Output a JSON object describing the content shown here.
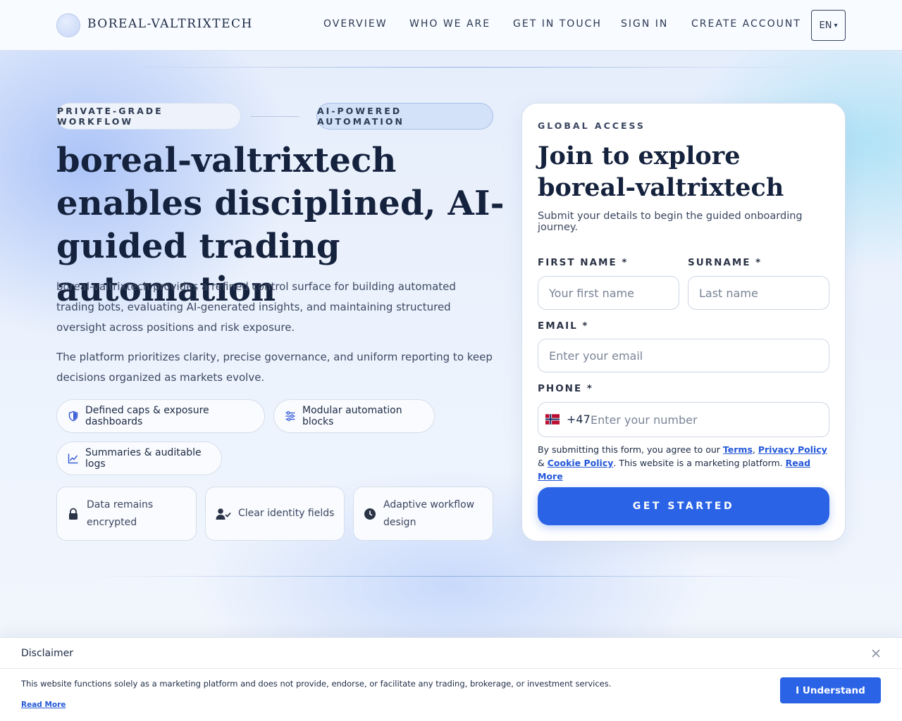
{
  "header": {
    "brand": "BOREAL-VALTRIXTECH",
    "nav": [
      "OVERVIEW",
      "WHO WE ARE",
      "GET IN TOUCH",
      "SIGN IN",
      "CREATE ACCOUNT"
    ],
    "language": "EN",
    "language_caret": "▾"
  },
  "hero": {
    "badge_left": "PRIVATE-GRADE WORKFLOW",
    "badge_right": "AI-POWERED AUTOMATION",
    "title": "boreal-valtrixtech enables disciplined, AI-guided trading automation",
    "paragraph_1": "boreal-valtrixtech provides a refined control surface for building automated trading bots, evaluating AI-generated insights, and maintaining structured oversight across positions and risk exposure.",
    "paragraph_2": "The platform prioritizes clarity, precise governance, and uniform reporting to keep decisions organized as markets evolve.",
    "chips": [
      {
        "icon": "shield-icon",
        "label": "Defined caps & exposure dashboards"
      },
      {
        "icon": "sliders-icon",
        "label": "Modular automation blocks"
      },
      {
        "icon": "chart-line-icon",
        "label": "Summaries & auditable logs"
      }
    ],
    "cards": [
      {
        "icon": "lock-icon",
        "label": "Data remains encrypted"
      },
      {
        "icon": "user-check-icon",
        "label": "Clear identity fields"
      },
      {
        "icon": "clock-icon",
        "label": "Adaptive workflow design"
      }
    ]
  },
  "form": {
    "eyebrow": "GLOBAL ACCESS",
    "title": "Join to explore boreal-valtrixtech",
    "subtitle": "Submit your details to begin the guided onboarding journey.",
    "first_name_label": "FIRST NAME *",
    "first_name_placeholder": "Your first name",
    "first_name_value": "",
    "surname_label": "SURNAME *",
    "surname_placeholder": "Last name",
    "surname_value": "",
    "email_label": "EMAIL *",
    "email_placeholder": "Enter your email",
    "email_value": "",
    "phone_label": "PHONE *",
    "phone_country_flag": "norway-flag-icon",
    "phone_dial_code": "+47",
    "phone_placeholder": "Enter your number",
    "phone_value": "",
    "consent_prefix": "By submitting this form, you agree to our ",
    "consent_terms": "Terms",
    "consent_comma": ", ",
    "consent_privacy": "Privacy Policy",
    "consent_and": " & ",
    "consent_cookie": "Cookie Policy",
    "consent_suffix": ". This website is a marketing platform. ",
    "consent_read_more": "Read More",
    "submit_label": "GET STARTED"
  },
  "disclaimer": {
    "title": "Disclaimer",
    "text": "This website functions solely as a marketing platform and does not provide, endorse, or facilitate any trading, brokerage, or investment services.",
    "read_more": "Read More",
    "button": "I Understand"
  },
  "colors": {
    "accent": "#2a63e6",
    "link": "#2458d8",
    "text_dark": "#15223d"
  }
}
